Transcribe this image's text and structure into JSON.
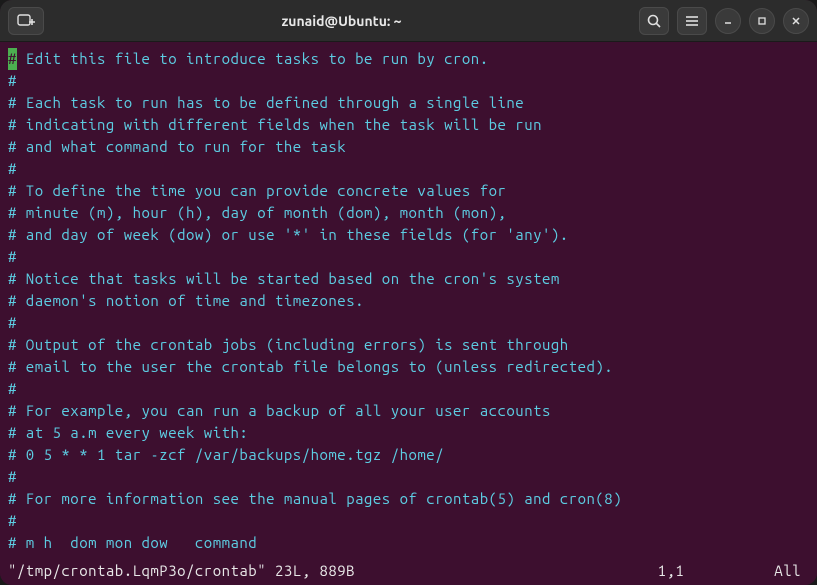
{
  "window": {
    "title": "zunaid@Ubuntu: ~"
  },
  "editor": {
    "lines": [
      " Edit this file to introduce tasks to be run by cron.",
      "#",
      "# Each task to run has to be defined through a single line",
      "# indicating with different fields when the task will be run",
      "# and what command to run for the task",
      "#",
      "# To define the time you can provide concrete values for",
      "# minute (m), hour (h), day of month (dom), month (mon),",
      "# and day of week (dow) or use '*' in these fields (for 'any').",
      "#",
      "# Notice that tasks will be started based on the cron's system",
      "# daemon's notion of time and timezones.",
      "#",
      "# Output of the crontab jobs (including errors) is sent through",
      "# email to the user the crontab file belongs to (unless redirected).",
      "#",
      "# For example, you can run a backup of all your user accounts",
      "# at 5 a.m every week with:",
      "# 0 5 * * 1 tar -zcf /var/backups/home.tgz /home/",
      "#",
      "# For more information see the manual pages of crontab(5) and cron(8)",
      "#",
      "# m h  dom mon dow   command"
    ],
    "cursor_char": "#",
    "status": {
      "file": "\"/tmp/crontab.LqmP3o/crontab\" 23L, 889B",
      "position": "1,1",
      "scroll": "All"
    }
  },
  "icons": {
    "new_tab": "new-tab-icon",
    "search": "search-icon",
    "menu": "hamburger-icon",
    "minimize": "minimize-icon",
    "maximize": "maximize-icon",
    "close": "close-icon"
  }
}
